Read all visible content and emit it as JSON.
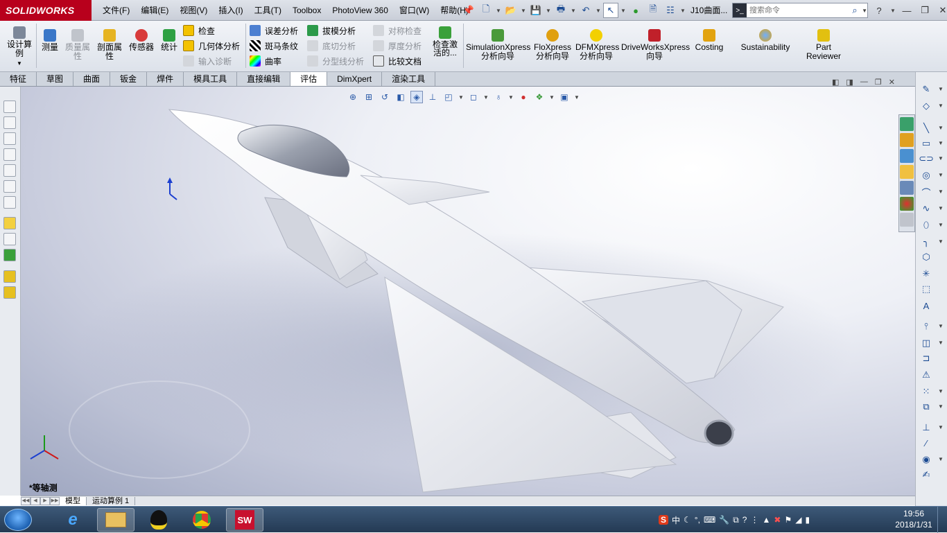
{
  "app": {
    "brand": "SOLIDWORKS",
    "document": "J10曲面..."
  },
  "menus": [
    "文件(F)",
    "编辑(E)",
    "视图(V)",
    "插入(I)",
    "工具(T)",
    "Toolbox",
    "PhotoView 360",
    "窗口(W)",
    "帮助(H)"
  ],
  "search": {
    "placeholder": "搜索命令"
  },
  "ribbon": {
    "design_study": "设计算例",
    "measure": "测量",
    "mass_props": "质量属性",
    "section_props": "剖面属性",
    "sensor": "传感器",
    "statistics": "统计",
    "check": "检查",
    "geometry_analysis": "几何体分析",
    "import_diagnostics": "输入诊断",
    "deviation": "误差分析",
    "zebra": "斑马条纹",
    "curvature": "曲率",
    "draft": "拔模分析",
    "undercut": "底切分析",
    "parting_line": "分型线分析",
    "symmetry": "对称检查",
    "thickness": "厚度分析",
    "compare": "比较文档",
    "check_active": "检查激活的...",
    "simulation_l1": "SimulationXpress",
    "simulation_l2": "分析向导",
    "flo_l1": "FloXpress",
    "flo_l2": "分析向导",
    "dfm_l1": "DFMXpress",
    "dfm_l2": "分析向导",
    "driveworks_l1": "DriveWorksXpress",
    "driveworks_l2": "向导",
    "costing": "Costing",
    "sustainability": "Sustainability",
    "part_reviewer_l1": "Part",
    "part_reviewer_l2": "Reviewer"
  },
  "tabs": [
    "特征",
    "草图",
    "曲面",
    "钣金",
    "焊件",
    "模具工具",
    "直接编辑",
    "评估",
    "DimXpert",
    "渲染工具"
  ],
  "active_tab": "评估",
  "viewport": {
    "view_name": "*等轴测"
  },
  "bottom_tabs": [
    "模型",
    "运动算例 1"
  ],
  "taskbar": {
    "time": "19:56",
    "date": "2018/1/31",
    "ime": "中"
  },
  "colors": {
    "brand": "#b8001c",
    "accent": "#1a4a92",
    "taskbar": "#2c4563"
  }
}
